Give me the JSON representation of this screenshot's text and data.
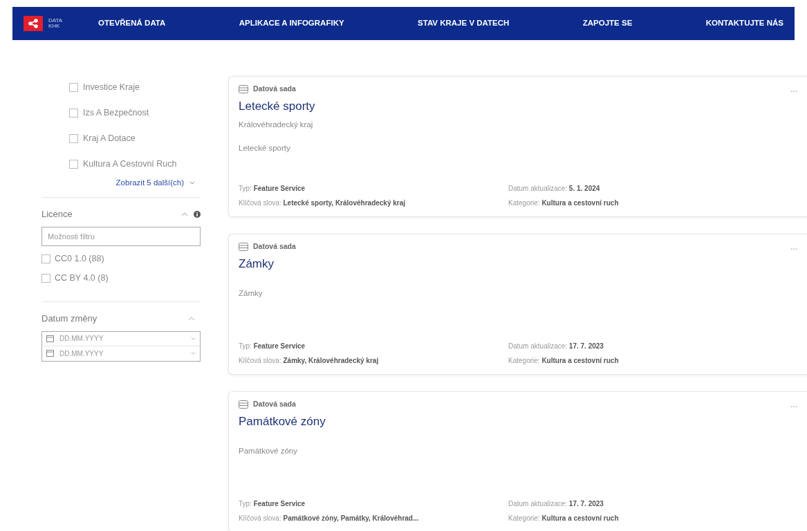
{
  "navbar": {
    "logo_text": "DATA KHK",
    "items": [
      {
        "label": "OTEVŘENÁ DATA",
        "selected": false
      },
      {
        "label": "APLIKACE A INFOGRAFIKY",
        "selected": false
      },
      {
        "label": "STAV KRAJE V DATECH",
        "selected": false
      },
      {
        "label": "ZAPOJTE SE",
        "selected": false
      },
      {
        "label": "KONTAKTUJTE NÁS",
        "selected": false
      }
    ]
  },
  "sidebar": {
    "category_items": [
      {
        "label": "Investice Kraje",
        "checked": false
      },
      {
        "label": "Izs A Bezpečnost",
        "checked": false
      },
      {
        "label": "Kraj A Dotace",
        "checked": false
      },
      {
        "label": "Kultura A Cestovní Ruch",
        "checked": false
      }
    ],
    "show_more": "Zobrazit 5 další(ch)",
    "license": {
      "title": "Licence",
      "expanded": true,
      "filter_placeholder": "Možnosti filtru",
      "items": [
        {
          "label": "CC0 1.0 (88)",
          "checked": false
        },
        {
          "label": "CC BY 4.0 (8)",
          "checked": false
        }
      ]
    },
    "date_changed": {
      "title": "Datum změny",
      "expanded": true,
      "from_placeholder": "DD.MM.YYYY",
      "to_placeholder": "DD.MM.YYYY"
    }
  },
  "results": [
    {
      "kind_label": "Datová sada",
      "title": "Letecké sporty",
      "owner": "Královéhradecký kraj",
      "description": "Letecké sporty",
      "more": "...",
      "meta": [
        "Typ: **Feature Service**",
        "Datum aktualizace: **5. 1. 2024**",
        "Klíčová slova: **Letecké sporty, Královéhradecký kraj**",
        "Kategorie: **Kultura a cestovní ruch**"
      ]
    },
    {
      "kind_label": "Datová sada",
      "title": "Zámky",
      "description": "Zámky",
      "more": "...",
      "meta": [
        "Typ: **Feature Service**",
        "Datum aktualizace: **17. 7. 2023**",
        "Klíčová slova: **Zámky, Královéhradecký kraj**",
        "Kategorie: **Kultura a cestovní ruch**"
      ]
    },
    {
      "kind_label": "Datová sada",
      "title": "Památkové zóny",
      "description": "Památkové zóny",
      "more": "...",
      "meta": [
        "Typ: **Feature Service**",
        "Datum aktualizace: **17. 7. 2023**",
        "Klíčová slova: **Památkové zóny, Památky, Královéhrad...**",
        "Kategorie: **Kultura a cestovní ruch**"
      ]
    }
  ]
}
